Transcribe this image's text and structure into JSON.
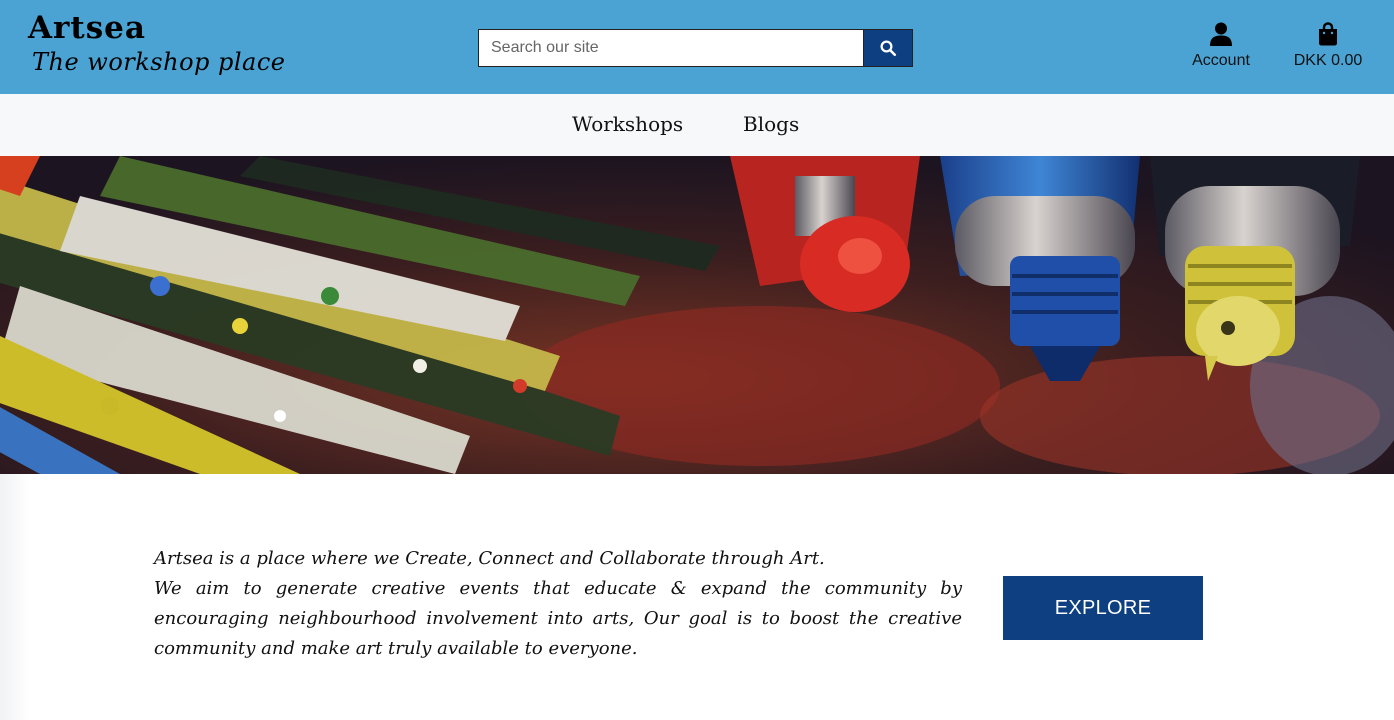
{
  "header": {
    "brand_name": "Artsea",
    "brand_tagline": "The workshop place",
    "search_placeholder": "Search our site",
    "account_label": "Account",
    "cart_label": "DKK 0.00"
  },
  "nav": {
    "items": [
      {
        "label": "Workshops"
      },
      {
        "label": "Blogs"
      }
    ]
  },
  "hero": {
    "icons": [
      "paintbrushes-and-paint-tubes-image"
    ]
  },
  "intro": {
    "line1": "Artsea is a place where we Create, Connect and Collaborate through Art.",
    "paragraph": "We aim to generate creative events that educate & expand the community by encouraging neighbourhood involvement into arts, Our goal is to boost the creative community and make art truly available to everyone.",
    "cta_label": "EXPLORE"
  },
  "colors": {
    "header_bg": "#4aa3d3",
    "nav_bg": "#f7f8f9",
    "accent": "#0e3f80"
  }
}
